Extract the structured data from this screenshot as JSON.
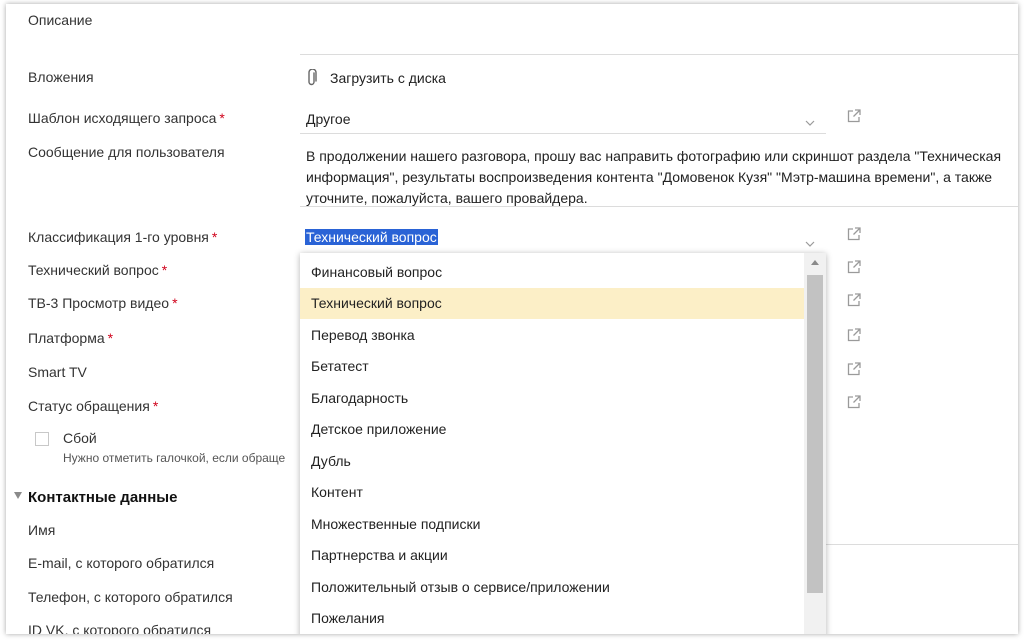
{
  "form": {
    "description_label": "Описание",
    "attachments_label": "Вложения",
    "upload_label": "Загрузить с диска",
    "template_label": "Шаблон исходящего запроса",
    "template_value": "Другое",
    "message_label": "Сообщение для пользователя",
    "message_text": "В продолжении нашего разговора, прошу вас направить фотографию или скриншот раздела \"Техническая информация\", результаты воспроизведения контента \"Домовенок Кузя\"  \"Мэтр-машина времени\", а также уточните, пожалуйста, вашего провайдера.",
    "class1_label": "Классификация 1-го уровня",
    "class1_value": "Технический вопрос",
    "tech_question_label": "Технический вопрос",
    "tv3_label": "ТВ-3 Просмотр видео",
    "platform_label": "Платформа",
    "smart_tv_label": "Smart TV",
    "status_label": "Статус обращения",
    "failure_label": "Сбой",
    "failure_hint": "Нужно отметить галочкой, если обраще",
    "required_mark": "*"
  },
  "contacts": {
    "section_title": "Контактные данные",
    "name_label": "Имя",
    "email_label": "E-mail, с которого обратился",
    "phone_label": "Телефон, с которого обратился",
    "vk_label": "ID VK, с которого обратился"
  },
  "dropdown": {
    "highlighted": "Технический вопрос",
    "items": [
      "Финансовый вопрос",
      "Технический вопрос",
      "Перевод звонка",
      "Бетатест",
      "Благодарность",
      "Детское приложение",
      "Дубль",
      "Контент",
      "Множественные подписки",
      "Партнерства и акции",
      "Положительный отзыв о сервисе/приложении",
      "Пожелания"
    ]
  },
  "colors": {
    "required": "#d0021b",
    "selection": "#2a63d6",
    "highlight_row": "#fcefc7",
    "scroll_thumb": "#c2c2c2"
  },
  "icons": {
    "attachment": "paperclip-icon",
    "external": "external-link-icon",
    "chevron": "chevron-down-icon",
    "scroll_up": "arrow-up-icon",
    "collapse": "triangle-down-icon"
  }
}
